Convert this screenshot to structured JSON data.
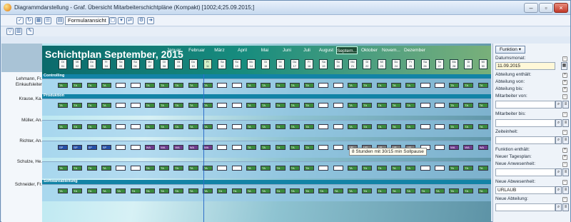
{
  "window": {
    "title": "Diagrammdarstellung - Graf. Übersicht Mitarbeiterschichtpläne (Kompakt) [1002;4;25.09.2015;]"
  },
  "toolbar": {
    "view_label": "Formularansicht"
  },
  "plan": {
    "title": "Schichtplan September, 2015",
    "months": [
      {
        "label": "Januar",
        "active": false
      },
      {
        "label": "Februar",
        "active": false
      },
      {
        "label": "März",
        "active": false
      },
      {
        "label": "April",
        "active": false
      },
      {
        "label": "Mai",
        "active": false
      },
      {
        "label": "Juni",
        "active": false
      },
      {
        "label": "Juli",
        "active": false
      },
      {
        "label": "August",
        "active": false
      },
      {
        "label": "Septem...",
        "active": true
      },
      {
        "label": "Oktober",
        "active": false
      },
      {
        "label": "Novem...",
        "active": false
      },
      {
        "label": "Dezember",
        "active": false
      }
    ],
    "days": [
      {
        "wd": "Di",
        "d": "01"
      },
      {
        "wd": "Mi",
        "d": "02"
      },
      {
        "wd": "Do",
        "d": "03"
      },
      {
        "wd": "Fr",
        "d": "04"
      },
      {
        "wd": "Sa",
        "d": "05"
      },
      {
        "wd": "So",
        "d": "06"
      },
      {
        "wd": "Mo",
        "d": "07"
      },
      {
        "wd": "Di",
        "d": "08"
      },
      {
        "wd": "Mi",
        "d": "09"
      },
      {
        "wd": "Do",
        "d": "10"
      },
      {
        "wd": "Fr",
        "d": "11"
      },
      {
        "wd": "Sa",
        "d": "12"
      },
      {
        "wd": "So",
        "d": "13"
      },
      {
        "wd": "Mo",
        "d": "14"
      },
      {
        "wd": "Di",
        "d": "15"
      },
      {
        "wd": "Mi",
        "d": "16"
      },
      {
        "wd": "Do",
        "d": "17"
      },
      {
        "wd": "Fr",
        "d": "18"
      },
      {
        "wd": "Sa",
        "d": "19"
      },
      {
        "wd": "So",
        "d": "20"
      },
      {
        "wd": "Mo",
        "d": "21"
      },
      {
        "wd": "Di",
        "d": "22"
      },
      {
        "wd": "Mi",
        "d": "23"
      },
      {
        "wd": "Do",
        "d": "24"
      },
      {
        "wd": "Fr",
        "d": "25"
      },
      {
        "wd": "Sa",
        "d": "26"
      },
      {
        "wd": "So",
        "d": "27"
      },
      {
        "wd": "Mo",
        "d": "28"
      },
      {
        "wd": "Di",
        "d": "29"
      },
      {
        "wd": "Mi",
        "d": "30"
      }
    ],
    "employees": [
      {
        "name": "Lehmann, Fr.",
        "dept": "Controlling",
        "dept_group": "Einkaufsleiter",
        "shifts": [
          "TA",
          "TA",
          "TA",
          "TA",
          "",
          "",
          "TA",
          "TA",
          "TA",
          "TA",
          "TA",
          "",
          "",
          "TA",
          "TA",
          "TA",
          "TA",
          "TA",
          "",
          "",
          "TA",
          "TA",
          "TA",
          "TA",
          "TA",
          "",
          "",
          "TA",
          "TA",
          "TA"
        ]
      },
      {
        "name": "Krause, Ka.",
        "dept": "Produktion",
        "shifts": [
          "TA",
          "TA",
          "TA",
          "TA",
          "",
          "",
          "TA",
          "TA",
          "TA",
          "TA",
          "TA",
          "",
          "",
          "TA",
          "TA",
          "TA",
          "TA",
          "TA",
          "",
          "",
          "TA",
          "TA",
          "TA",
          "TA",
          "TA",
          "",
          "",
          "TA",
          "TA",
          "TA"
        ]
      },
      {
        "name": "Müller, An.",
        "shifts": [
          "TA",
          "TA",
          "TA",
          "TA",
          "",
          "",
          "TA",
          "TA",
          "TA",
          "TA",
          "TA",
          "",
          "",
          "TA",
          "TA",
          "TA",
          "TA",
          "TA",
          "",
          "",
          "TA",
          "TA",
          "TA",
          "TA",
          "TA",
          "",
          "",
          "TA",
          "TA",
          "TA"
        ]
      },
      {
        "name": "Richter, An.",
        "shifts": [
          "SP",
          "SP",
          "SP",
          "SP",
          "",
          "",
          "WA",
          "WA",
          "WA",
          "WA",
          "WA",
          "",
          "",
          "TA",
          "TA",
          "TA",
          "TA",
          "TA",
          "",
          "",
          "UR",
          "UR",
          "UR",
          "UR",
          "UR",
          "",
          "",
          "WA",
          "WA",
          "WA"
        ]
      },
      {
        "name": "Schulze, He.",
        "shifts": [
          "TA",
          "TA",
          "TA",
          "TA",
          "",
          "",
          "TA",
          "TA",
          "TA",
          "TA",
          "TA",
          "",
          "",
          "TA",
          "TA",
          "TA",
          "TA",
          "TA",
          "",
          "",
          "TA",
          "TA",
          "TA",
          "TA",
          "TA",
          "",
          "",
          "TA",
          "TA",
          "TA"
        ]
      },
      {
        "name": "Schneider, Fr.",
        "dept": "Softwareableitung",
        "shifts": [
          "TA",
          "TA",
          "TA",
          "TA",
          "TA",
          "TA",
          "TA",
          "TA",
          "TA",
          "TA",
          "TA",
          "TA",
          "TA",
          "TA",
          "TA",
          "TA",
          "TA",
          "TA",
          "TA",
          "TA",
          "TA",
          "TA",
          "TA",
          "TA",
          "TA",
          "TA",
          "TA",
          "TA",
          "TA",
          "TA"
        ]
      }
    ],
    "tooltip": "8 Stunden mit 30/15 min Sollpause"
  },
  "side": {
    "funktion_label": "Funktion",
    "datumsmonat_label": "Datumsmonat:",
    "datumsmonat_value": "11.09.2015",
    "abteilung_enthaelt_label": "Abteilung enthält:",
    "abteilung_von_label": "Abteilung von:",
    "abteilung_bis_label": "Abteilung bis:",
    "mitarbeiter_von_label": "Mitarbeiter von:",
    "mitarbeiter_bis_label": "Mitarbeiter bis:",
    "zeiteinheit_label": "Zeiteinheit:",
    "funktion_enthaelt_label": "Funktion enthält:",
    "neuer_tagesplan_label": "Neuer Tagesplan:",
    "neue_anwesenheit_label": "Neue Anwesenheit:",
    "neue_abwesenheit_label": "Neue Abwesenheit:",
    "neue_abwesenheit_value": "URLAUB",
    "neue_abteilung_label": "Neue Abteilung:"
  },
  "colors": {
    "shift_ta": "#3a8a3c",
    "shift_wa": "#6d3a8c",
    "shift_sp": "#2550a8",
    "shift_ur": "#777777",
    "accent": "#2f70c8"
  }
}
